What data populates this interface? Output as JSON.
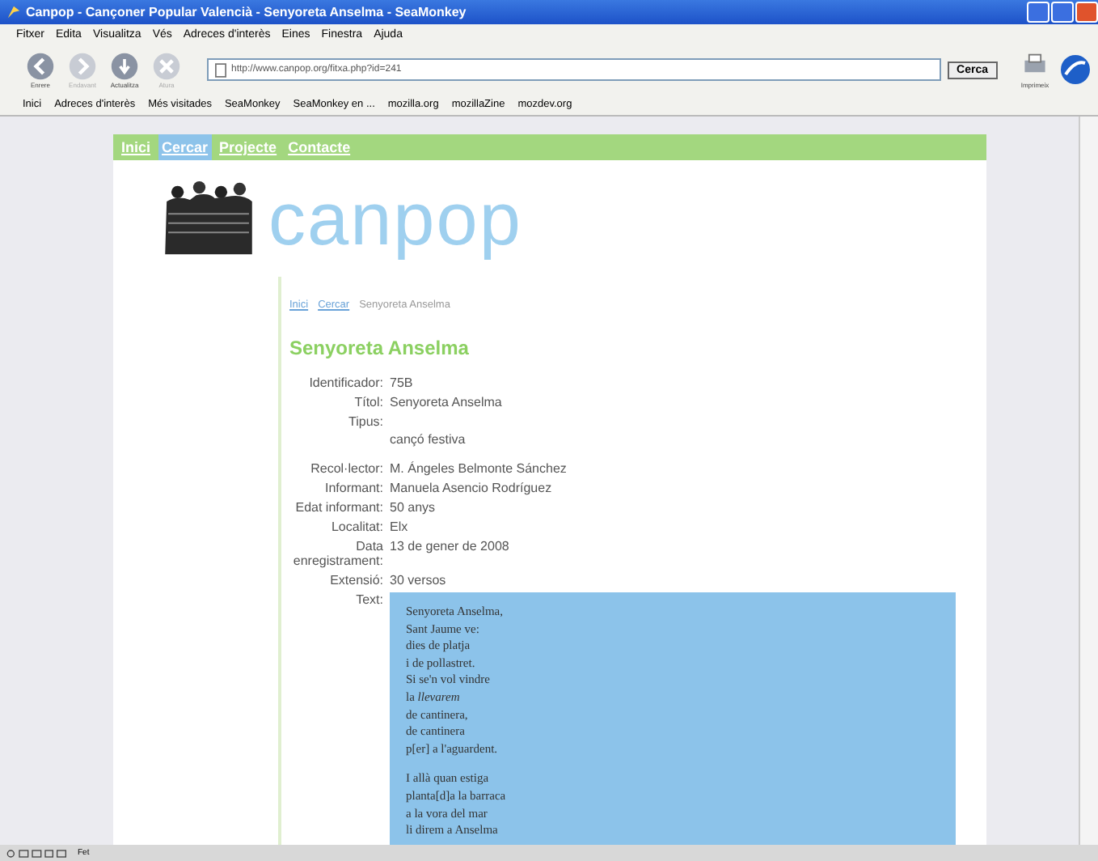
{
  "window": {
    "title": "Canpop - Cançoner Popular Valencià - Senyoreta Anselma - SeaMonkey"
  },
  "menu": [
    "Fitxer",
    "Edita",
    "Visualitza",
    "Vés",
    "Adreces d'interès",
    "Eines",
    "Finestra",
    "Ajuda"
  ],
  "toolbar": {
    "buttons": [
      {
        "label": "Enrere",
        "disabled": false
      },
      {
        "label": "Endavant",
        "disabled": true
      },
      {
        "label": "Actualitza",
        "disabled": false
      },
      {
        "label": "Atura",
        "disabled": true
      }
    ],
    "url": "http://www.canpop.org/fitxa.php?id=241",
    "search_button": "Cerca",
    "print_label": "Imprimeix"
  },
  "bookmarks": [
    "Inici",
    "Adreces d'interès",
    "Més visitades",
    "SeaMonkey",
    "SeaMonkey en ...",
    "mozilla.org",
    "mozillaZine",
    "mozdev.org"
  ],
  "nav": [
    {
      "label": "Inici",
      "selected": false
    },
    {
      "label": "Cercar",
      "selected": true
    },
    {
      "label": "Projecte",
      "selected": false
    },
    {
      "label": "Contacte",
      "selected": false
    }
  ],
  "logo_text": "canpop",
  "breadcrumb": {
    "links": [
      "Inici",
      "Cercar"
    ],
    "current": "Senyoreta Anselma"
  },
  "heading": "Senyoreta Anselma",
  "fields": [
    {
      "label": "Identificador:",
      "value": "75B"
    },
    {
      "label": "Títol:",
      "value": "Senyoreta Anselma"
    },
    {
      "label": "Tipus:",
      "value": "cançó festiva",
      "kind": "below"
    },
    {
      "label": "Recol·lector:",
      "value": "M. Ángeles Belmonte Sánchez",
      "kind": "gap"
    },
    {
      "label": "Informant:",
      "value": "Manuela Asencio Rodríguez"
    },
    {
      "label": "Edat informant:",
      "value": "50 anys"
    },
    {
      "label": "Localitat:",
      "value": "Elx"
    },
    {
      "label": "Data enregistrament:",
      "value": "13 de gener de 2008"
    },
    {
      "label": "Extensió:",
      "value": "30 versos"
    }
  ],
  "text_label": "Text:",
  "poem": [
    [
      "Senyoreta Anselma,",
      "Sant Jaume ve:",
      "dies de platja",
      "i de pollastret.",
      "Si se'n vol vindre",
      "la *llevarem*",
      "de cantinera,",
      "de cantinera",
      "p[er] a l'aguardent."
    ],
    [
      "I allà quan estiga",
      "planta[d]a la barraca",
      "a la vora del mar",
      "li direm a Anselma"
    ]
  ],
  "status_text": "Fet"
}
